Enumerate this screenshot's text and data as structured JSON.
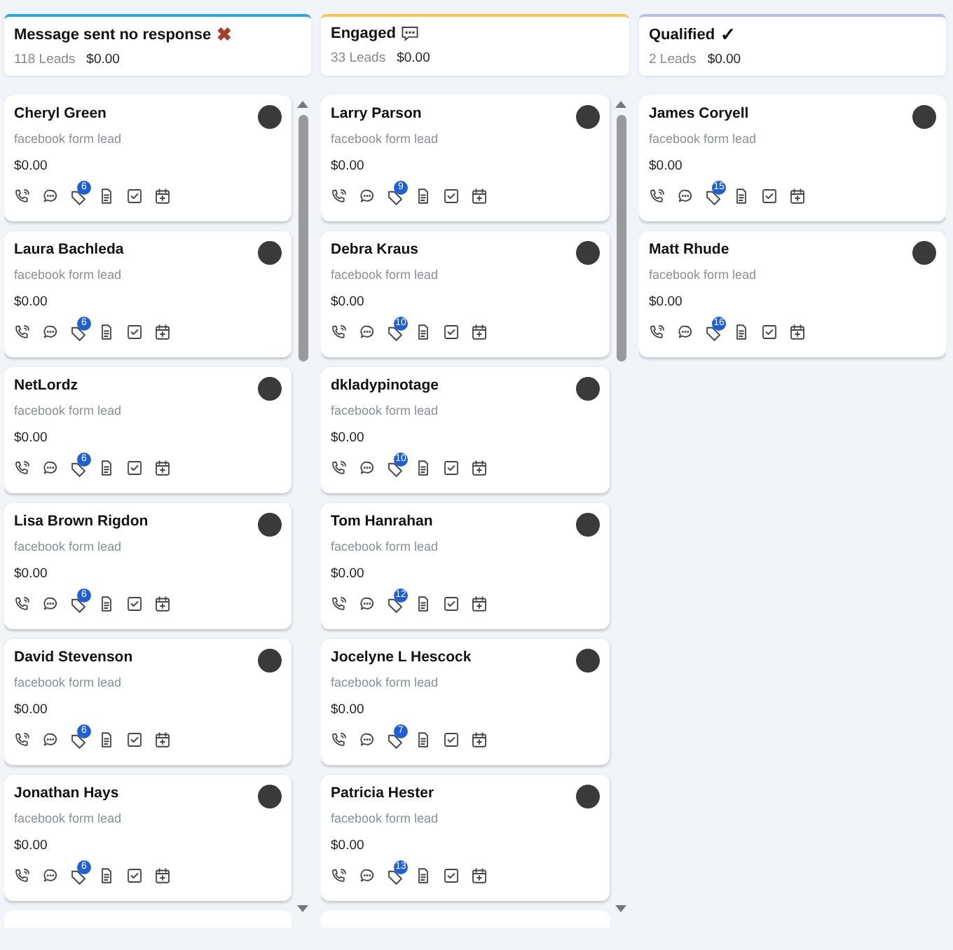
{
  "columns": [
    {
      "title": "Message sent no response",
      "kind": "cross",
      "title_mark": "✖",
      "color": "#2aa6dc",
      "count": "118 Leads",
      "amount": "$0.00",
      "scrollable": true,
      "cards": [
        {
          "name": "Cheryl Green",
          "source": "facebook form lead",
          "value": "$0.00",
          "badge": "6"
        },
        {
          "name": "Laura Bachleda",
          "source": "facebook form lead",
          "value": "$0.00",
          "badge": "6"
        },
        {
          "name": "NetLordz",
          "source": "facebook form lead",
          "value": "$0.00",
          "badge": "6"
        },
        {
          "name": "Lisa Brown Rigdon",
          "source": "facebook form lead",
          "value": "$0.00",
          "badge": "6"
        },
        {
          "name": "David Stevenson",
          "source": "facebook form lead",
          "value": "$0.00",
          "badge": "6"
        },
        {
          "name": "Jonathan Hays",
          "source": "facebook form lead",
          "value": "$0.00",
          "badge": "6"
        }
      ]
    },
    {
      "title": "Engaged",
      "kind": "chat",
      "color": "#f2c94c",
      "count": "33 Leads",
      "amount": "$0.00",
      "scrollable": true,
      "cards": [
        {
          "name": "Larry Parson",
          "source": "facebook form lead",
          "value": "$0.00",
          "badge": "9"
        },
        {
          "name": "Debra Kraus",
          "source": "facebook form lead",
          "value": "$0.00",
          "badge": "10"
        },
        {
          "name": "dkladypinotage",
          "source": "facebook form lead",
          "value": "$0.00",
          "badge": "10"
        },
        {
          "name": "Tom Hanrahan",
          "source": "facebook form lead",
          "value": "$0.00",
          "badge": "12"
        },
        {
          "name": "Jocelyne L Hescock",
          "source": "facebook form lead",
          "value": "$0.00",
          "badge": "7"
        },
        {
          "name": "Patricia Hester",
          "source": "facebook form lead",
          "value": "$0.00",
          "badge": "13"
        }
      ]
    },
    {
      "title": "Qualified",
      "kind": "check",
      "title_mark": "✓",
      "color": "#b7c0e3",
      "count": "2 Leads",
      "amount": "$0.00",
      "scrollable": false,
      "cards": [
        {
          "name": "James Coryell",
          "source": "facebook form lead",
          "value": "$0.00",
          "badge": "15"
        },
        {
          "name": "Matt Rhude",
          "source": "facebook form lead",
          "value": "$0.00",
          "badge": "16"
        }
      ]
    }
  ]
}
